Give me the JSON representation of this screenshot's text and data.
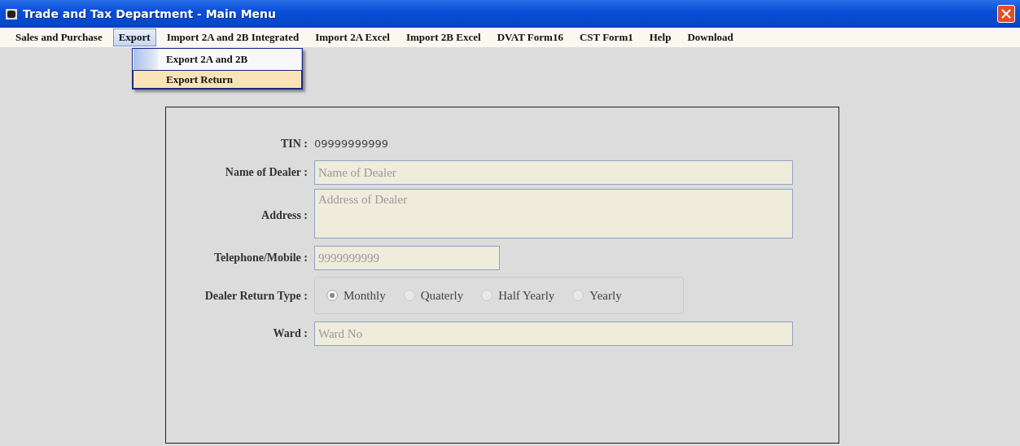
{
  "window": {
    "title": "Trade and Tax Department - Main Menu"
  },
  "menu_bar": [
    {
      "label": "Sales and Purchase",
      "selected": false
    },
    {
      "label": "Export",
      "selected": true
    },
    {
      "label": "Import 2A and 2B Integrated",
      "selected": false
    },
    {
      "label": "Import 2A Excel",
      "selected": false
    },
    {
      "label": "Import 2B Excel",
      "selected": false
    },
    {
      "label": "DVAT Form16",
      "selected": false
    },
    {
      "label": "CST Form1",
      "selected": false
    },
    {
      "label": "Help",
      "selected": false
    },
    {
      "label": "Download",
      "selected": false
    }
  ],
  "dropdown": [
    {
      "label": "Export 2A and 2B",
      "selected": false
    },
    {
      "label": "Export Return",
      "selected": true
    }
  ],
  "form": [
    {
      "kind": "static",
      "label": "TIN :",
      "value": "09999999999"
    },
    {
      "kind": "text",
      "label": "Name of Dealer :",
      "placeholder": "Name of Dealer"
    },
    {
      "kind": "textarea",
      "label": "Address :",
      "placeholder": "Address of Dealer"
    },
    {
      "kind": "short",
      "label": "Telephone/Mobile :",
      "placeholder": "9999999999"
    },
    {
      "kind": "radio",
      "label": "Dealer Return Type :",
      "options": [
        {
          "label": "Monthly",
          "selected": true
        },
        {
          "label": "Quaterly",
          "selected": false
        },
        {
          "label": "Half Yearly",
          "selected": false
        },
        {
          "label": "Yearly",
          "selected": false
        }
      ]
    },
    {
      "kind": "text",
      "label": "Ward :",
      "placeholder": "Ward No"
    }
  ]
}
